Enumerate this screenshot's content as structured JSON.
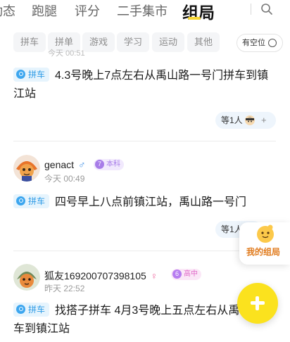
{
  "tabs": [
    {
      "label": "动态"
    },
    {
      "label": "跑腿"
    },
    {
      "label": "评分"
    },
    {
      "label": "二手集市"
    },
    {
      "label": "组局"
    }
  ],
  "filters": [
    "拼车",
    "拼单",
    "游戏",
    "学习",
    "运动",
    "其他"
  ],
  "filter_toggle_label": "有空位",
  "peek_time": "今天 00:51",
  "posts": [
    {
      "tag": "拼车",
      "text": "4.3号晚上7点左右从禹山路一号门拼车到镇江站",
      "join_label": "等1人",
      "join_plus": "+"
    },
    {
      "user": "genact",
      "gender_symbol": "♂",
      "gender_color": "#3a8ee6",
      "badge_level": "7",
      "badge_label": "本科",
      "time": "今天 00:49",
      "tag": "拼车",
      "text": "四号早上八点前镇江站，禹山路一号门",
      "join_label": "等1人"
    },
    {
      "user": "狐友169200707398105",
      "gender_symbol": "♀",
      "gender_color": "#ef6aa0",
      "badge_level": "6",
      "badge_label": "高中",
      "time": "昨天 22:52",
      "tag": "拼车",
      "text": "找搭子拼车 4月3号晚上五点左右从禹山路拼车到镇江站"
    }
  ],
  "my_group_label": "我的组局",
  "colors": {
    "accent_yellow": "#fbe21e",
    "tag_blue": "#2e9be6",
    "badge_purple": "#a77ce8",
    "badge_pink": "#e067c8"
  }
}
